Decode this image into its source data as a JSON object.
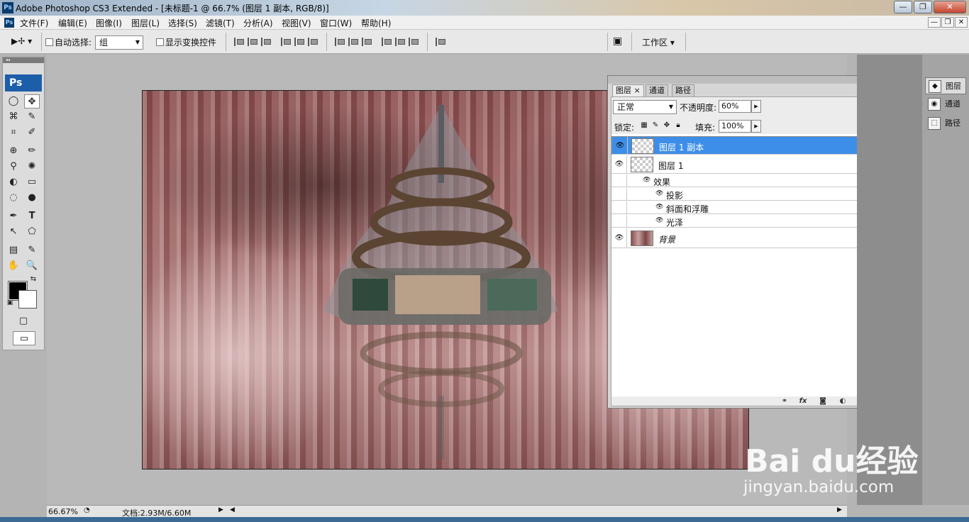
{
  "window": {
    "title": "Adobe Photoshop CS3 Extended - [未标题-1 @ 66.7% (图层 1 副本, RGB/8)]",
    "app_icon_text": "Ps",
    "btn_minimize": "—",
    "btn_maximize": "❐",
    "btn_close": "✕"
  },
  "menubar": {
    "items": [
      "文件(F)",
      "编辑(E)",
      "图像(I)",
      "图层(L)",
      "选择(S)",
      "滤镜(T)",
      "分析(A)",
      "视图(V)",
      "窗口(W)",
      "帮助(H)"
    ],
    "doc_minimize": "—",
    "doc_restore": "❐",
    "doc_close": "✕"
  },
  "options": {
    "tool_icon": "▶✢ ▾",
    "auto_select_label": "自动选择:",
    "auto_select_value": "组",
    "show_transform_label": "显示变换控件",
    "workspace_label": "工作区 ▾"
  },
  "toolbox": {
    "logo": "Ps",
    "tools": [
      "◯",
      "✥",
      "⌘",
      "✎",
      "⌗",
      "✐",
      "⊕",
      "✏",
      "⚲",
      "✺",
      "◐",
      "▭",
      "◌",
      "●",
      "✒",
      "T",
      "↖",
      "⬠",
      "▤",
      "✎",
      "✋",
      "🔍",
      "⇆",
      "▣",
      "▢"
    ]
  },
  "layers_panel": {
    "tabs": [
      "图层",
      "通道",
      "路径"
    ],
    "tab_close": "×",
    "blend_mode": "正常",
    "opacity_label": "不透明度:",
    "opacity_value": "60%",
    "lock_label": "锁定:",
    "fill_label": "填充:",
    "fill_value": "100%",
    "layers": [
      {
        "name": "图层 1 副本",
        "selected": true
      },
      {
        "name": "图层 1",
        "fx": "fx"
      },
      {
        "name": "背景",
        "locked": true
      }
    ],
    "effects_label": "效果",
    "effects": [
      "投影",
      "斜面和浮雕",
      "光泽"
    ],
    "bottom_icons": [
      "link-icon",
      "fx-icon",
      "mask-icon",
      "adjustment-icon",
      "folder-icon",
      "new-layer-icon",
      "trash-icon"
    ]
  },
  "dock": {
    "items": [
      "图层",
      "通道",
      "路径"
    ]
  },
  "status": {
    "zoom": "66.67%",
    "doc_info": "文档:2.93M/6.60M"
  },
  "watermark": {
    "brand": "Bai du经验",
    "url": "jingyan.baidu.com"
  }
}
